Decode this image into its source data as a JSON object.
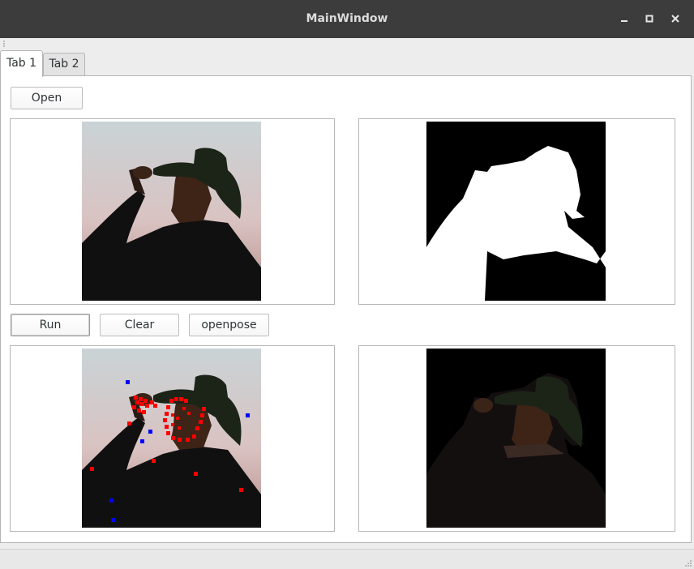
{
  "window": {
    "title": "MainWindow",
    "controls": [
      "minimize-icon",
      "maximize-icon",
      "close-icon"
    ]
  },
  "tabs": [
    {
      "label": "Tab 1",
      "active": true
    },
    {
      "label": "Tab 2",
      "active": false
    }
  ],
  "toolbar": {
    "open_label": "Open"
  },
  "actions": {
    "run_label": "Run",
    "clear_label": "Clear",
    "openpose_label": "openpose"
  },
  "images": {
    "original": "original-photo",
    "mask": "segmentation-mask",
    "keypoints": "pose-keypoints-overlay",
    "cutout": "background-removed-photo"
  },
  "colors": {
    "titlebar": "#3c3c3c",
    "keypoint_red": "#ff0000",
    "keypoint_blue": "#0000ff",
    "mask_background": "#000000",
    "mask_foreground": "#ffffff"
  }
}
